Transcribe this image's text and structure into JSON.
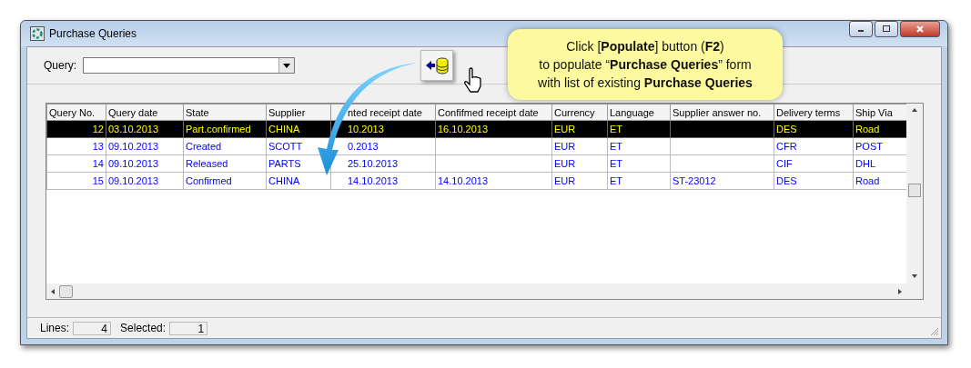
{
  "window": {
    "title": "Purchase Queries"
  },
  "query": {
    "label": "Query:"
  },
  "callout": {
    "lines": [
      "Click [**Populate**] button (**F2**)",
      "to populate “**Purchase Queries**” form",
      "with list of existing **Purchase Queries**"
    ]
  },
  "table": {
    "columns": [
      "Query No.",
      "Query date",
      "State",
      "Supplier",
      "nted receipt date",
      "Confifmed receipt date",
      "Currency",
      "Language",
      "Supplier answer no.",
      "Delivery terms",
      "Ship Via"
    ],
    "rows": [
      {
        "selected": true,
        "cells": [
          "12",
          "03.10.2013",
          "Part.confirmed",
          "CHINA",
          "10.2013",
          "16.10.2013",
          "EUR",
          "ET",
          "",
          "DES",
          "Road"
        ]
      },
      {
        "selected": false,
        "cells": [
          "13",
          "09.10.2013",
          "Created",
          "SCOTT",
          "0.2013",
          "",
          "EUR",
          "ET",
          "",
          "CFR",
          "POST"
        ]
      },
      {
        "selected": false,
        "cells": [
          "14",
          "09.10.2013",
          "Released",
          "PARTS",
          "25.10.2013",
          "",
          "EUR",
          "ET",
          "",
          "CIF",
          "DHL"
        ]
      },
      {
        "selected": false,
        "cells": [
          "15",
          "09.10.2013",
          "Confirmed",
          "CHINA",
          "14.10.2013",
          "14.10.2013",
          "EUR",
          "ET",
          "ST-23012",
          "DES",
          "Road"
        ]
      }
    ]
  },
  "status_bar": {
    "lines_label": "Lines:",
    "lines_value": "4",
    "selected_label": "Selected:",
    "selected_value": "1"
  }
}
